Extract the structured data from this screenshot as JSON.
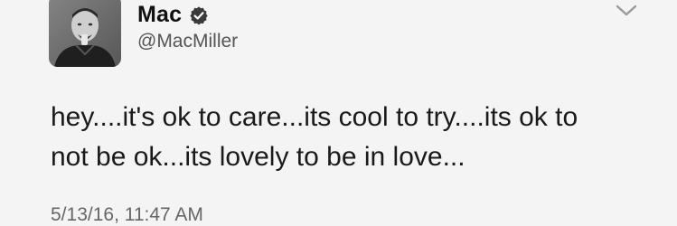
{
  "tweet": {
    "author": {
      "display_name": "Mac",
      "handle": "@MacMiller",
      "verified": true,
      "avatar_icon": "profile-photo"
    },
    "text_lines": [
      "hey....it's ok to care...its cool to try....its ok to",
      "not be ok...its lovely to be in love..."
    ],
    "timestamp": "5/13/16, 11:47 AM",
    "menu_icon": "chevron-down-icon"
  },
  "colors": {
    "background": "#f4f4f4",
    "verified_badge": "#3a3a3a",
    "text": "#1a1a1a",
    "secondary_text": "#666666"
  }
}
